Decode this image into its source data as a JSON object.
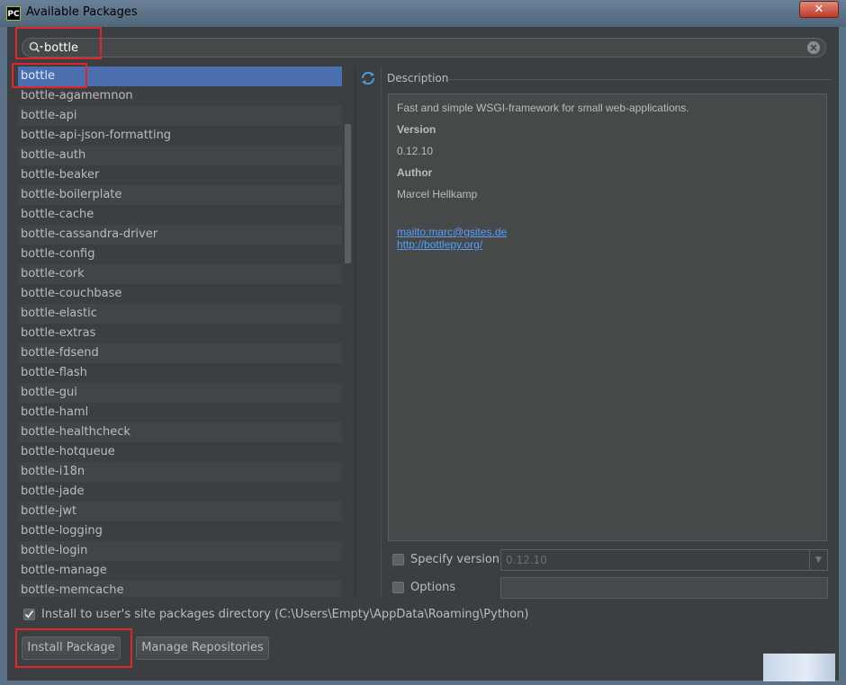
{
  "window": {
    "title": "Available Packages",
    "app_icon": "PC",
    "close_glyph": "✕"
  },
  "search": {
    "value": "bottle",
    "icon": "search-icon",
    "clear_icon": "clear-icon"
  },
  "packages": [
    "bottle",
    "bottle-agamemnon",
    "bottle-api",
    "bottle-api-json-formatting",
    "bottle-auth",
    "bottle-beaker",
    "bottle-boilerplate",
    "bottle-cache",
    "bottle-cassandra-driver",
    "bottle-config",
    "bottle-cork",
    "bottle-couchbase",
    "bottle-elastic",
    "bottle-extras",
    "bottle-fdsend",
    "bottle-flash",
    "bottle-gui",
    "bottle-haml",
    "bottle-healthcheck",
    "bottle-hotqueue",
    "bottle-i18n",
    "bottle-jade",
    "bottle-jwt",
    "bottle-logging",
    "bottle-login",
    "bottle-manage",
    "bottle-memcache"
  ],
  "selected_package": "bottle",
  "description": {
    "label": "Description",
    "summary": "Fast and simple WSGI-framework for small web-applications.",
    "version_heading": "Version",
    "version": "0.12.10",
    "author_heading": "Author",
    "author": "Marcel Hellkamp",
    "mailto": "mailto:marc@gsites.de",
    "homepage": "http://bottlepy.org/"
  },
  "options": {
    "specify_version_label": "Specify version",
    "version_value": "0.12.10",
    "options_label": "Options",
    "options_value": ""
  },
  "install_user_site_label": "Install to user's site packages directory (C:\\Users\\Empty\\AppData\\Roaming\\Python)",
  "buttons": {
    "install": "Install Package",
    "manage_repos": "Manage Repositories"
  },
  "colors": {
    "background": "#3c3f41",
    "selection": "#4b6eaf",
    "link": "#589df6",
    "highlight_box": "#e0262b"
  }
}
